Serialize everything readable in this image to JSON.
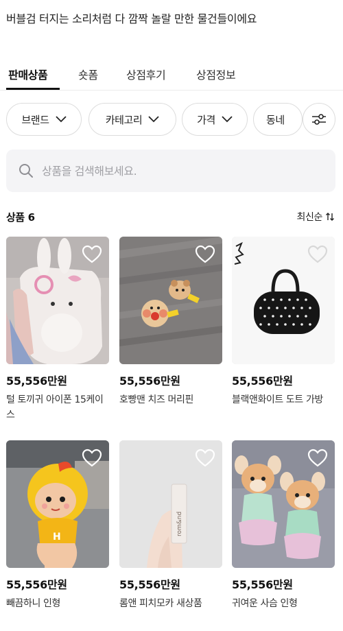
{
  "intro_text": "버블검 터지는 소리처럼 다 깜짝 놀랄 만한 물건들이에요",
  "tabs": [
    {
      "label": "판매상품",
      "active": true
    },
    {
      "label": "숏폼",
      "active": false
    },
    {
      "label": "상점후기",
      "active": false
    },
    {
      "label": "상점정보",
      "active": false
    }
  ],
  "filters": [
    {
      "label": "브랜드",
      "icon": "chevron-down-icon"
    },
    {
      "label": "카테고리",
      "icon": "chevron-down-icon"
    },
    {
      "label": "가격",
      "icon": "chevron-down-icon"
    },
    {
      "label": "동네"
    }
  ],
  "filter_settings_icon": "sliders-icon",
  "search": {
    "placeholder": "상품을 검색해보세요.",
    "value": "",
    "icon": "search-icon"
  },
  "product_count_label": "상품 6",
  "sort_label": "최신순",
  "sort_icon": "sort-arrows-icon",
  "heart_icon": "heart-outline-icon",
  "products": [
    {
      "price": "55,556만원",
      "title": "털 토끼귀 아이폰 15케이스"
    },
    {
      "price": "55,556만원",
      "title": "호빵맨 치즈 머리핀"
    },
    {
      "price": "55,556만원",
      "title": "블랙앤화이트 도트 가방"
    },
    {
      "price": "55,556만원",
      "title": "빼끔하니 인형"
    },
    {
      "price": "55,556만원",
      "title": "롬앤 피치모카 새상품"
    },
    {
      "price": "55,556만원",
      "title": "귀여운 사슴 인형"
    }
  ],
  "colors": {
    "text": "#111111",
    "chip_border": "#dcdcdc",
    "search_bg": "#f4f4f6",
    "placeholder": "#a0a0a5"
  }
}
